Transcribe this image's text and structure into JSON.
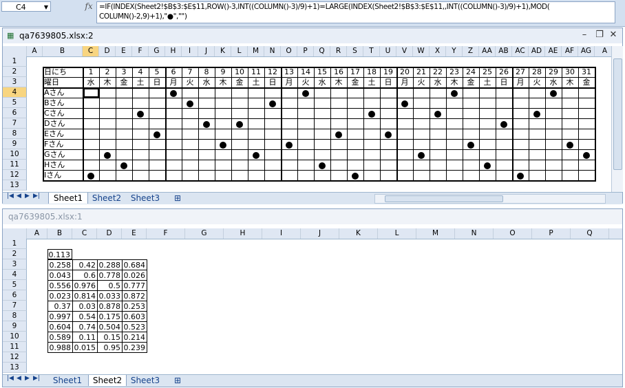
{
  "formula_bar": {
    "cell_ref": "C4",
    "fx_label": "fx",
    "formula_line1": "=IF(INDEX(Sheet2!$B$3:$E$11,ROW()-3,INT((COLUMN()-3)/9)+1)=LARGE(INDEX(Sheet2!$B$3:$E$11,,INT((COLUMN()-3)/9)+1),MOD(",
    "formula_line2": "COLUMN()-2,9)+1),\"●\",\"\")"
  },
  "window_top": {
    "title": "qa7639805.xlsx:2",
    "columns": [
      "A",
      "B",
      "C",
      "D",
      "E",
      "F",
      "G",
      "H",
      "I",
      "J",
      "K",
      "L",
      "M",
      "N",
      "O",
      "P",
      "Q",
      "R",
      "S",
      "T",
      "U",
      "V",
      "W",
      "X",
      "Y",
      "Z",
      "AA",
      "AB",
      "AC",
      "AD",
      "AE",
      "AF",
      "AG",
      "A"
    ],
    "rows": [
      "1",
      "2",
      "3",
      "4",
      "5",
      "6",
      "7",
      "8",
      "9",
      "10",
      "11",
      "12",
      "13"
    ],
    "header_label": "日にち",
    "weekday_label": "曜日",
    "days": [
      "1",
      "2",
      "3",
      "4",
      "5",
      "6",
      "7",
      "8",
      "9",
      "10",
      "11",
      "12",
      "13",
      "14",
      "15",
      "16",
      "17",
      "18",
      "19",
      "20",
      "21",
      "22",
      "23",
      "24",
      "25",
      "26",
      "27",
      "28",
      "29",
      "30",
      "31"
    ],
    "weekdays": [
      "水",
      "木",
      "金",
      "土",
      "日",
      "月",
      "火",
      "水",
      "木",
      "金",
      "土",
      "日",
      "月",
      "火",
      "水",
      "木",
      "金",
      "土",
      "日",
      "月",
      "火",
      "水",
      "木",
      "金",
      "土",
      "日",
      "月",
      "火",
      "水",
      "木",
      "金"
    ],
    "people": [
      "Aさん",
      "Bさん",
      "Cさん",
      "Dさん",
      "Eさん",
      "Fさん",
      "Gさん",
      "Hさん",
      "Iさん"
    ],
    "marks": [
      [
        6,
        14,
        23,
        29
      ],
      [
        7,
        12,
        20
      ],
      [
        4,
        18,
        22,
        28
      ],
      [
        8,
        10,
        26
      ],
      [
        5,
        16,
        19
      ],
      [
        9,
        13,
        24,
        30
      ],
      [
        2,
        11,
        21,
        31
      ],
      [
        3,
        15,
        25
      ],
      [
        1,
        17,
        27
      ]
    ],
    "tabs": [
      "Sheet1",
      "Sheet2",
      "Sheet3"
    ],
    "active_tab": "Sheet1"
  },
  "window_bottom": {
    "title": "qa7639805.xlsx:1",
    "columns": [
      "A",
      "B",
      "C",
      "D",
      "E",
      "F",
      "G",
      "H",
      "I",
      "J",
      "K",
      "L",
      "M",
      "N",
      "O",
      "P",
      "Q"
    ],
    "rows": [
      "1",
      "2",
      "3",
      "4",
      "5",
      "6",
      "7",
      "8",
      "9",
      "10",
      "11",
      "12",
      "13"
    ],
    "b2": "0.113",
    "table": [
      [
        "0.258",
        "0.42",
        "0.288",
        "0.684"
      ],
      [
        "0.043",
        "0.6",
        "0.778",
        "0.026"
      ],
      [
        "0.556",
        "0.976",
        "0.5",
        "0.777"
      ],
      [
        "0.023",
        "0.814",
        "0.033",
        "0.872"
      ],
      [
        "0.37",
        "0.03",
        "0.878",
        "0.253"
      ],
      [
        "0.997",
        "0.54",
        "0.175",
        "0.603"
      ],
      [
        "0.604",
        "0.74",
        "0.504",
        "0.523"
      ],
      [
        "0.589",
        "0.11",
        "0.15",
        "0.214"
      ],
      [
        "0.988",
        "0.015",
        "0.95",
        "0.239"
      ]
    ],
    "tabs": [
      "Sheet1",
      "Sheet2",
      "Sheet3"
    ],
    "active_tab": "Sheet2"
  },
  "colors": {
    "frame": "#d3e0f0",
    "header": "#dfe7f3",
    "active_col": "#f8d580",
    "link": "#15428b"
  }
}
